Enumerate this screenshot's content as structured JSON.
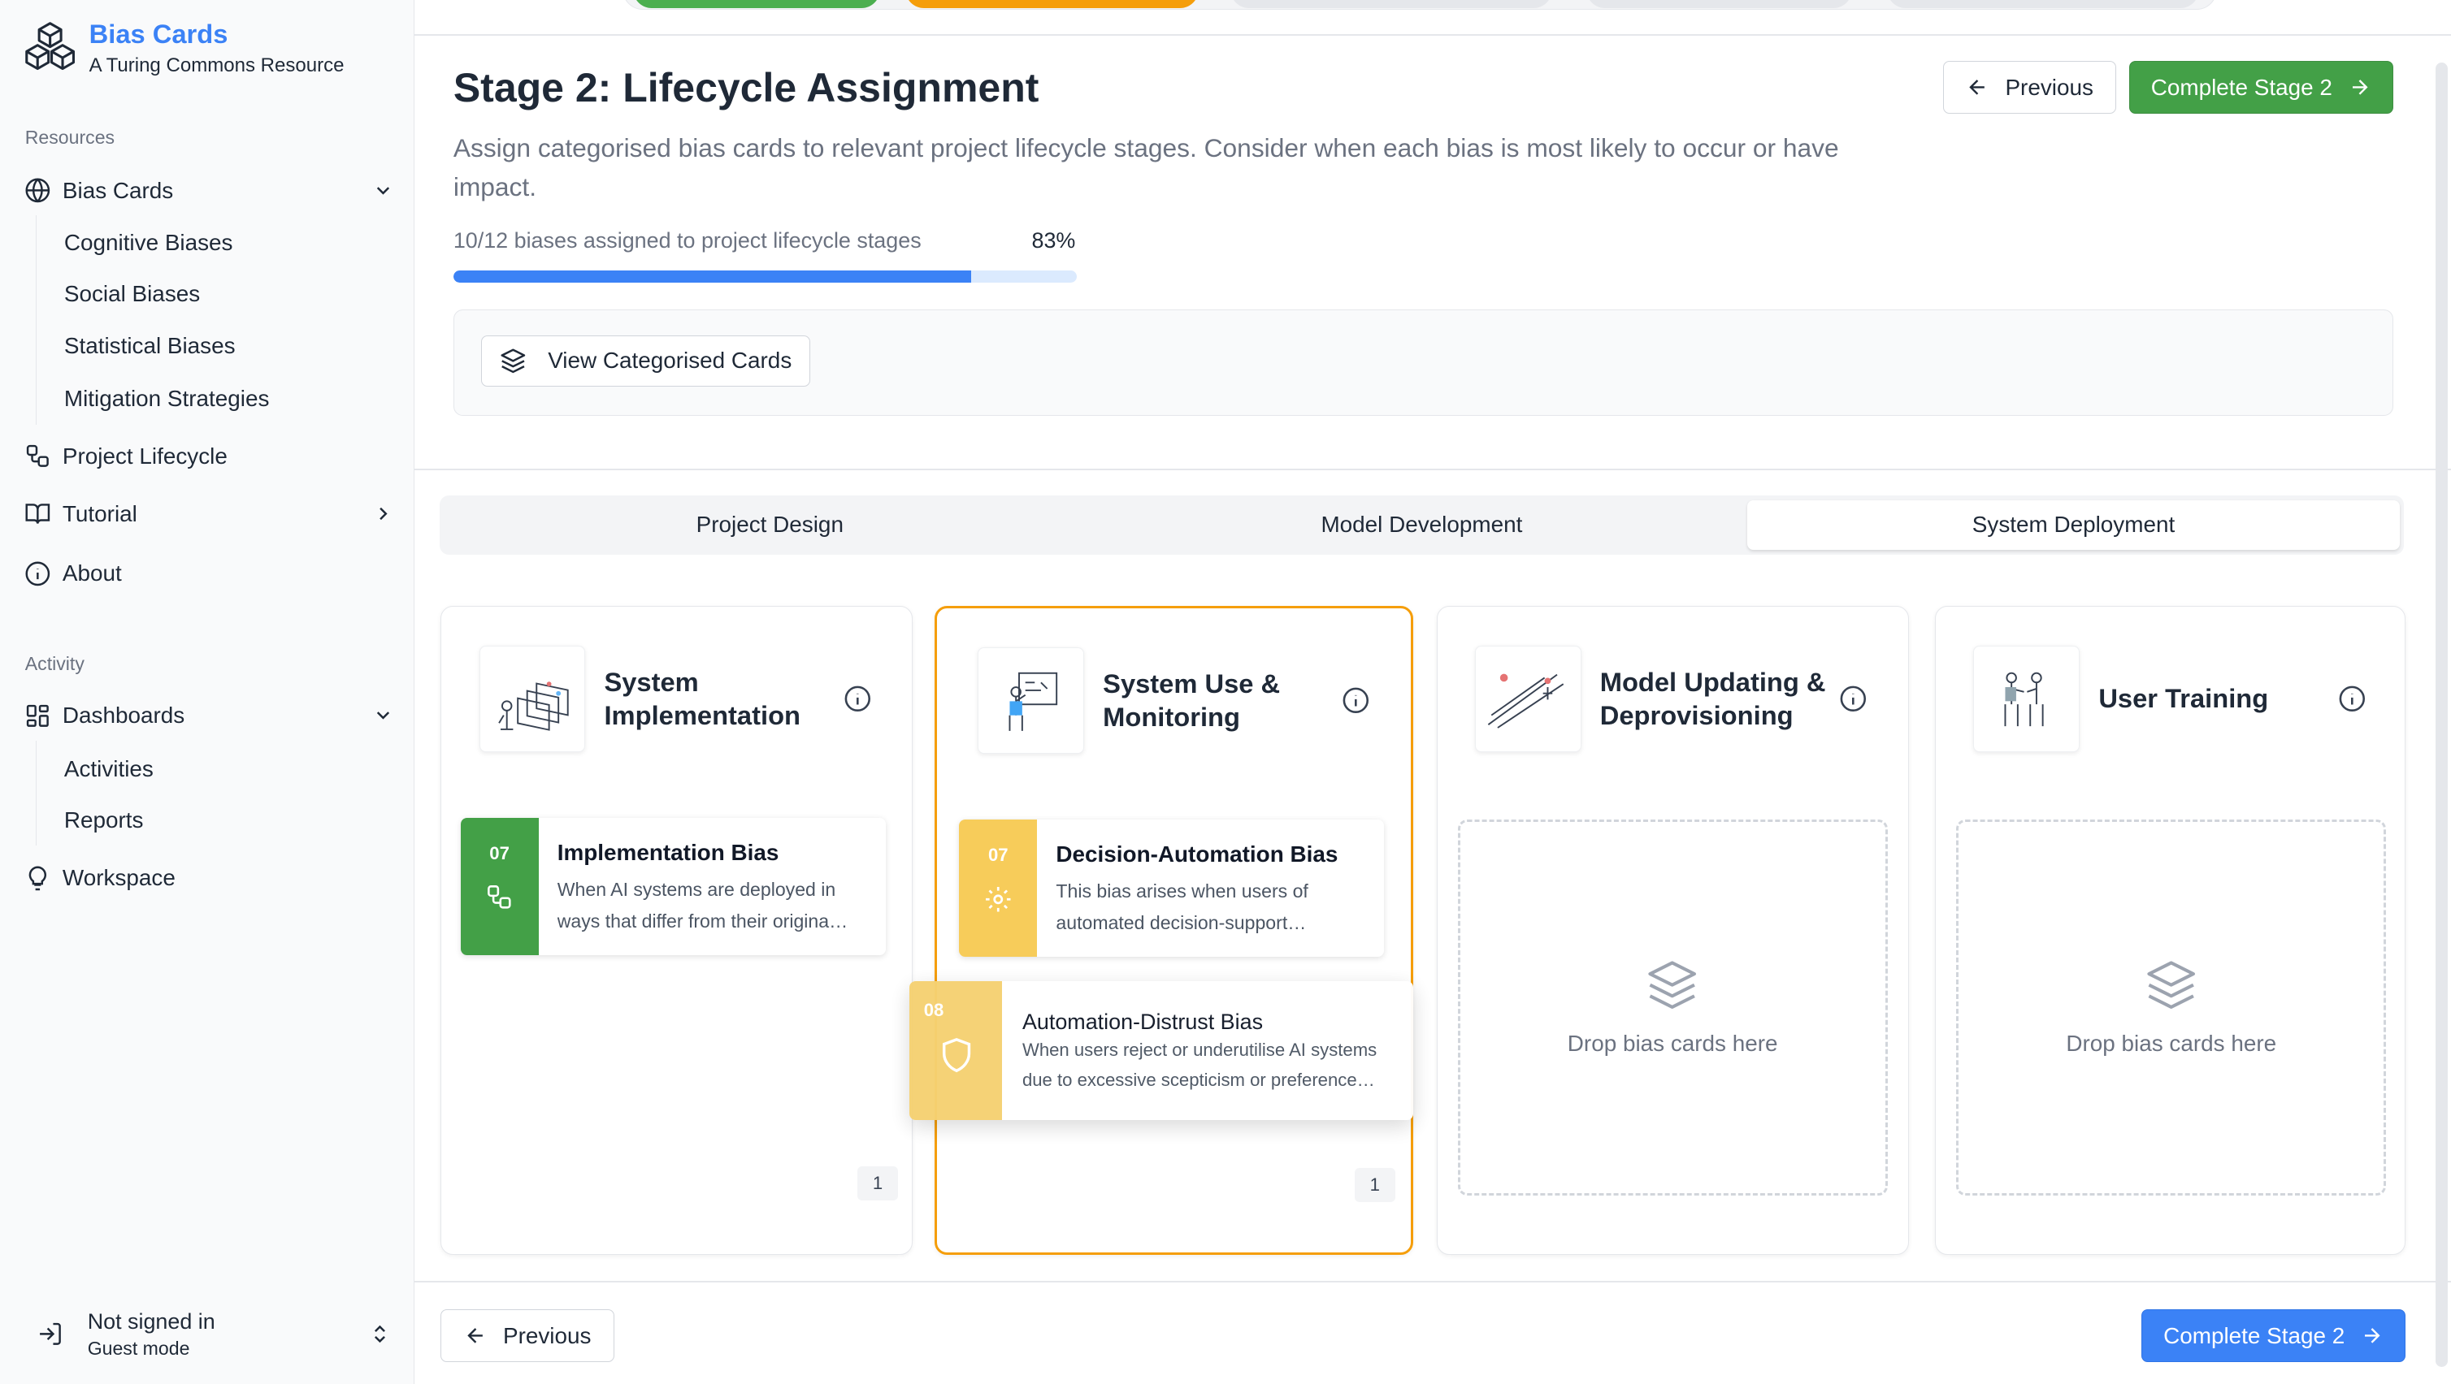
{
  "app": {
    "title": "Bias Cards",
    "subtitle": "A Turing Commons Resource"
  },
  "sidebar": {
    "resources_label": "Resources",
    "bias_cards": "Bias Cards",
    "bias_cards_sub": [
      "Cognitive Biases",
      "Social Biases",
      "Statistical Biases",
      "Mitigation Strategies"
    ],
    "project_lifecycle": "Project Lifecycle",
    "tutorial": "Tutorial",
    "about": "About",
    "activity_label": "Activity",
    "dashboards": "Dashboards",
    "dashboards_sub": [
      "Activities",
      "Reports"
    ],
    "workspace": "Workspace",
    "user_status": "Not signed in",
    "user_mode": "Guest mode"
  },
  "header": {
    "title": "Stage 2: Lifecycle Assignment",
    "description": "Assign categorised bias cards to relevant project lifecycle stages. Consider when each bias is most likely to occur or have impact.",
    "progress_label": "10/12 biases assigned to project lifecycle stages",
    "progress_percent": "83%",
    "progress_value": 0.83,
    "previous_label": "Previous",
    "complete_label": "Complete Stage 2",
    "view_cards_label": "View Categorised Cards"
  },
  "colors": {
    "accent_blue": "#3b82f6",
    "green": "#43a047",
    "orange": "#f59e0b",
    "card_yellow": "#f7cc5a"
  },
  "tabs": [
    {
      "label": "Project Design"
    },
    {
      "label": "Model Development"
    },
    {
      "label": "System Deployment"
    }
  ],
  "columns": [
    {
      "title": "System Implementation",
      "count": "1",
      "card": {
        "number": "07",
        "title": "Implementation Bias",
        "line1": "When AI systems are deployed in",
        "line2": "ways that differ from their origina…",
        "icon": "flow-icon"
      }
    },
    {
      "title": "System Use & Monitoring",
      "count": "1",
      "card": {
        "number": "07",
        "title": "Decision-Automation Bias",
        "line1": "This bias arises when users of",
        "line2": "automated decision-support…",
        "icon": "gear-icon"
      }
    },
    {
      "title": "Model Updating & Deprovisioning",
      "drop_text": "Drop bias cards here"
    },
    {
      "title": "User Training",
      "drop_text": "Drop bias cards here"
    }
  ],
  "dragging_card": {
    "number": "08",
    "title": "Automation-Distrust Bias",
    "line1": "When users reject or underutilise AI systems",
    "line2": "due to excessive scepticism or preference…",
    "icon": "shield-icon"
  },
  "footer": {
    "previous_label": "Previous",
    "complete_label": "Complete Stage 2"
  }
}
